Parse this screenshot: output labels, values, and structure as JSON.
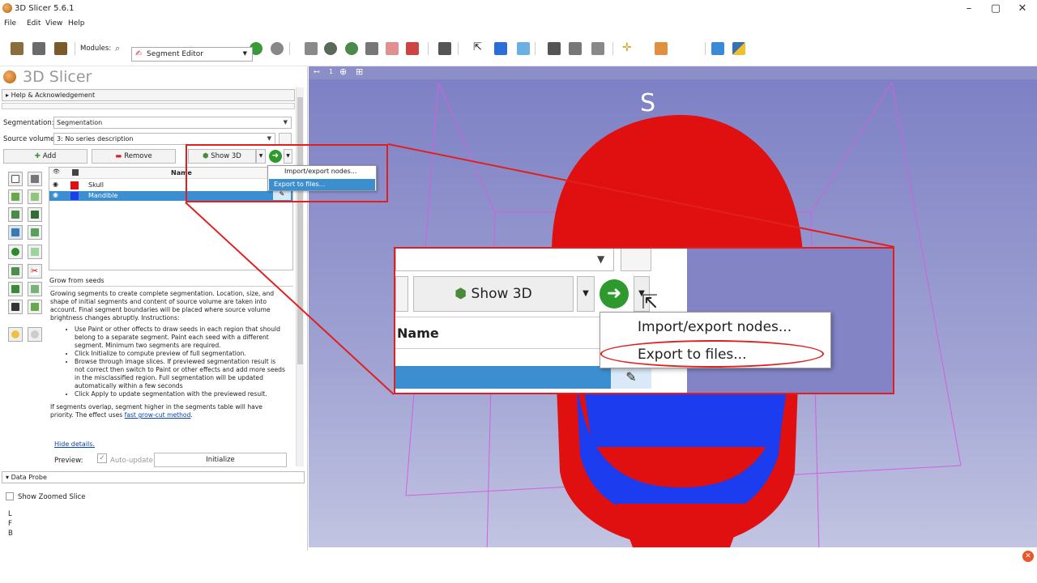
{
  "window": {
    "title": "3D Slicer 5.6.1",
    "minimize": "–",
    "maximize": "▢",
    "close": "✕"
  },
  "menu": [
    "File",
    "Edit",
    "View",
    "Help"
  ],
  "toolbar": {
    "modules_label": "Modules:",
    "module_selected": "Segment Editor"
  },
  "logo_text": "3D Slicer",
  "help_section": "Help & Acknowledgement",
  "segmentation": {
    "label": "Segmentation:",
    "value": "Segmentation"
  },
  "source_volume": {
    "label": "Source volume:",
    "value": "3: No series description"
  },
  "buttons": {
    "add": "Add",
    "remove": "Remove",
    "show3d": "Show 3D"
  },
  "table": {
    "header_name": "Name",
    "rows": [
      {
        "name": "Skull",
        "color": "#e01010",
        "selected": false
      },
      {
        "name": "Mandible",
        "color": "#1c3cf0",
        "selected": true
      }
    ]
  },
  "menu_popup": {
    "item1": "Import/export nodes...",
    "item2": "Export to files..."
  },
  "effect": {
    "title": "Grow from seeds",
    "intro": "Growing segments to create complete segmentation. Location, size, and shape of initial segments and content of source volume are taken into account. Final segment boundaries will be placed where source volume brightness changes abruptly. Instructions:",
    "bullets": [
      "Use Paint or other offects to draw seeds in each region that should belong to a separate segment. Paint each seed with a different segment. Minimum two segments are required.",
      "Click Initialize to compute preview of full segmentation.",
      "Browse through image slices. If previewed segmentation result is not correct then switch to Paint or other effects and add more seeds in the misclassified region. Full segmentation will be updated automatically within a few seconds",
      "Click Apply to update segmentation with the previewed result."
    ],
    "overlap_pre": "If segments overlap, segment higher in the segments table will have priority. The effect uses ",
    "overlap_link": "fast grow-cut method",
    "overlap_post": ".",
    "hide_details": "Hide details.",
    "preview_label": "Preview:",
    "auto_update": "Auto-update",
    "initialize": "Initialize"
  },
  "data_probe": {
    "title": "Data Probe",
    "show_zoomed": "Show Zoomed Slice",
    "coords": [
      "L",
      "F",
      "B"
    ]
  },
  "viewer": {
    "orientation": "S",
    "view_index": "1"
  },
  "colors": {
    "accent_selected": "#3b8fd1",
    "callout_red": "#e02020",
    "skull_red": "#e01010",
    "mandible_blue": "#1c3cf0"
  }
}
